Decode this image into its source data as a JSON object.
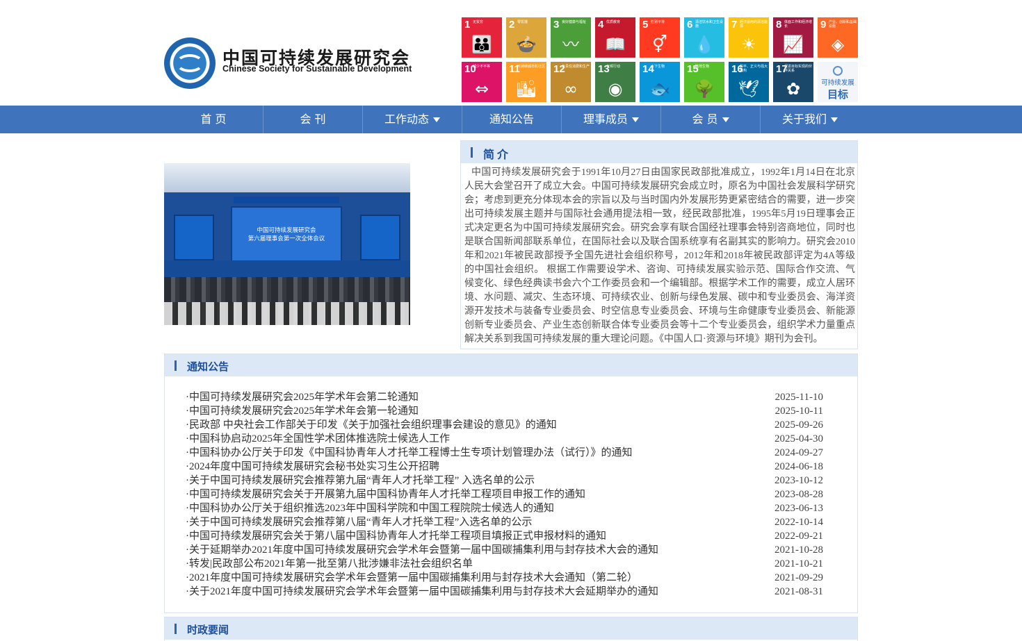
{
  "header": {
    "org_cn": "中国可持续发展研究会",
    "org_en": "Chinese Society for Sustainable Development",
    "sdg_logo": {
      "line1": "可持续发展",
      "line2": "目标"
    },
    "sdg_goals": [
      {
        "num": "1",
        "label": "无贫穷",
        "color": "#e5243b",
        "icon": "family-icon"
      },
      {
        "num": "2",
        "label": "零饥饿",
        "color": "#dda63a",
        "icon": "bowl-icon"
      },
      {
        "num": "3",
        "label": "良好健康与福祉",
        "color": "#4c9f38",
        "icon": "heartbeat-icon"
      },
      {
        "num": "4",
        "label": "优质教育",
        "color": "#c5192d",
        "icon": "book-icon"
      },
      {
        "num": "5",
        "label": "性别平等",
        "color": "#ff3a21",
        "icon": "gender-icon"
      },
      {
        "num": "6",
        "label": "清洁饮水和卫生设施",
        "color": "#26bde2",
        "icon": "water-icon"
      },
      {
        "num": "7",
        "label": "经济适用的清洁能源",
        "color": "#fcc30b",
        "icon": "sun-icon"
      },
      {
        "num": "8",
        "label": "体面工作和经济增长",
        "color": "#a21942",
        "icon": "growth-chart-icon"
      },
      {
        "num": "9",
        "label": "产业、创新和基础设施",
        "color": "#fd6925",
        "icon": "cubes-icon"
      },
      {
        "num": "10",
        "label": "减少不平等",
        "color": "#dd1367",
        "icon": "equality-icon"
      },
      {
        "num": "11",
        "label": "可持续城市和社区",
        "color": "#fd9d24",
        "icon": "city-icon"
      },
      {
        "num": "12",
        "label": "负责任消费和生产",
        "color": "#bf8b2e",
        "icon": "infinity-icon"
      },
      {
        "num": "13",
        "label": "气候行动",
        "color": "#3f7e44",
        "icon": "eye-earth-icon"
      },
      {
        "num": "14",
        "label": "水下生物",
        "color": "#0a97d9",
        "icon": "fish-icon"
      },
      {
        "num": "15",
        "label": "陆地生物",
        "color": "#56c02b",
        "icon": "tree-icon"
      },
      {
        "num": "16",
        "label": "和平、正义与强大机构",
        "color": "#00689d",
        "icon": "dove-icon"
      },
      {
        "num": "17",
        "label": "促进目标实现的伙伴关系",
        "color": "#19486a",
        "icon": "flower-icon"
      }
    ]
  },
  "nav": {
    "items": [
      {
        "label": "首 页",
        "dropdown": false
      },
      {
        "label": "会 刊",
        "dropdown": false
      },
      {
        "label": "工作动态",
        "dropdown": true
      },
      {
        "label": "通知公告",
        "dropdown": false
      },
      {
        "label": "理事成员",
        "dropdown": true
      },
      {
        "label": "会 员",
        "dropdown": true
      },
      {
        "label": "关于我们",
        "dropdown": true
      }
    ]
  },
  "photo": {
    "screen_line1": "中国可持续发展研究会",
    "screen_line2": "第六届理事会第一次全体会议"
  },
  "intro": {
    "title": "简介",
    "text": "中国可持续发展研究会于1991年10月27日由国家民政部批准成立，1992年1月14日在北京人民大会堂召开了成立大会。中国可持续发展研究会成立时，原名为中国社会发展科学研究会；考虑到更充分体现本会的宗旨以及与当时国内外发展形势更紧密结合的需要，进一步突出可持续发展主题并与国际社会通用提法相一致，经民政部批准，1995年5月19日理事会正式决定更名为中国可持续发展研究会。研究会享有联合国经社理事会特别咨商地位，同时也是联合国新闻部联系单位，在国际社会以及联合国系统享有名副其实的影响力。研究会2010年和2021年被民政部授予全国先进社会组织称号，2012年和2018年被民政部评定为4A等级的中国社会组织。 根据工作需要设学术、咨询、可持续发展实验示范、国际合作交流、气候变化、绿色经典读书会六个工作委员会和一个编辑部。根据学术工作的需要，成立人居环境、水问题、减灾、生态环境、可持续农业、创新与绿色发展、碳中和专业委员会、海洋资源开发技术与装备专业委员会、时空信息专业委员会、环境与生命健康专业委员会、新能源创新专业委员会、产业生态创新联合体专业委员会等十二个专业委员会，组织学术力量重点解决关系到我国可持续发展的重大理论问题。《中国人口·资源与环境》期刊为会刊。"
  },
  "notices": {
    "title": "通知公告",
    "items": [
      {
        "title": "·中国可持续发展研究会2025年学术年会第二轮通知",
        "date": "2025-11-10"
      },
      {
        "title": "·中国可持续发展研究会2025年学术年会第一轮通知",
        "date": "2025-10-11"
      },
      {
        "title": "·民政部 中央社会工作部关于印发《关于加强社会组织理事会建设的意见》的通知",
        "date": "2025-09-26"
      },
      {
        "title": "·中国科协启动2025年全国性学术团体推选院士候选人工作",
        "date": "2025-04-30"
      },
      {
        "title": "·中国科协办公厅关于印发《中国科协青年人才托举工程博士生专项计划管理办法（试行）》的通知",
        "date": "2024-09-27"
      },
      {
        "title": "·2024年度中国可持续发展研究会秘书处实习生公开招聘",
        "date": "2024-06-18"
      },
      {
        "title": "·关于中国可持续发展研究会推荐第九届“青年人才托举工程” 入选名单的公示",
        "date": "2023-10-12"
      },
      {
        "title": "·中国可持续发展研究会关于开展第九届中国科协青年人才托举工程项目申报工作的通知",
        "date": "2023-08-28"
      },
      {
        "title": "·中国科协办公厅关于组织推选2023年中国科学院和中国工程院院士候选人的通知",
        "date": "2023-06-13"
      },
      {
        "title": "·关于中国可持续发展研究会推荐第八届“青年人才托举工程”入选名单的公示",
        "date": "2022-10-14"
      },
      {
        "title": "·中国可持续发展研究会关于第八届中国科协青年人才托举工程项目填报正式申报材料的通知",
        "date": "2022-09-21"
      },
      {
        "title": "·关于延期举办2021年度中国可持续发展研究会学术年会暨第一届中国碳捕集利用与封存技术大会的通知",
        "date": "2021-10-28"
      },
      {
        "title": "·转发|民政部公布2021年第一批至第八批涉嫌非法社会组织名单",
        "date": "2021-10-21"
      },
      {
        "title": "·2021年度中国可持续发展研究会学术年会暨第一届中国碳捕集利用与封存技术大会通知（第二轮）",
        "date": "2021-09-29"
      },
      {
        "title": "·关于2021年度中国可持续发展研究会学术年会暨第一届中国碳捕集利用与封存技术大会延期举办的通知",
        "date": "2021-08-31"
      }
    ]
  },
  "news": {
    "title": "时政要闻"
  },
  "colors": {
    "nav_bg": "#3f74bd",
    "section_head_bg": "#dce8f5",
    "section_title": "#1e4f9a"
  }
}
